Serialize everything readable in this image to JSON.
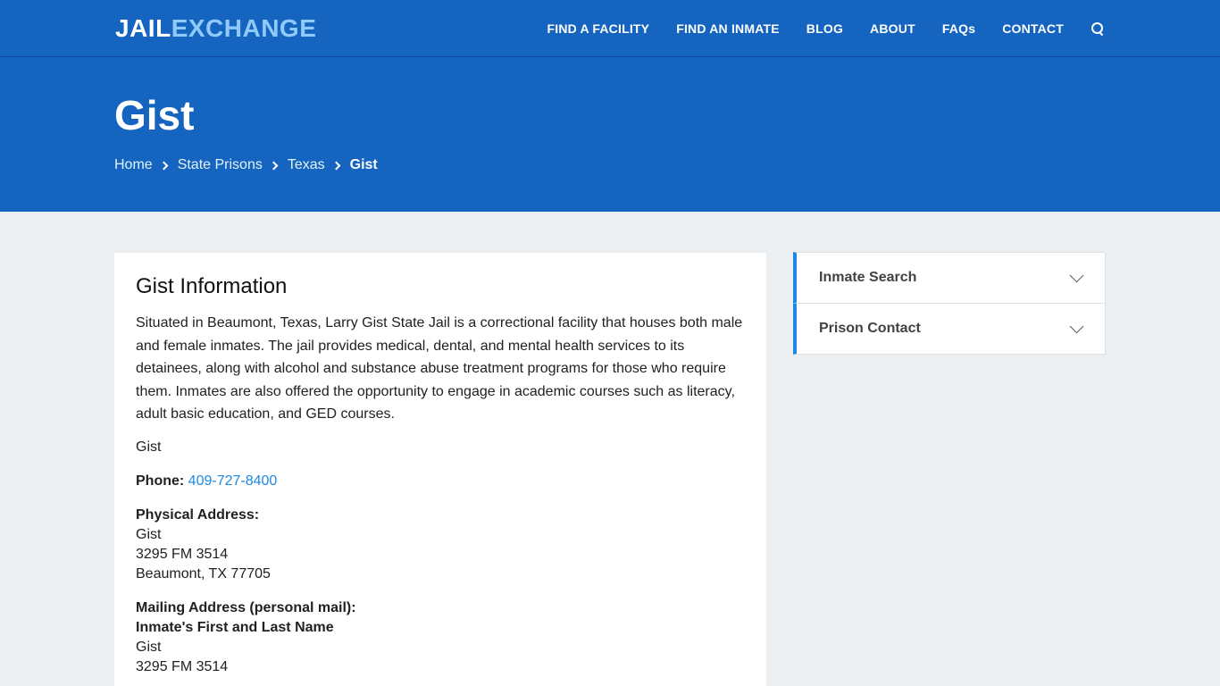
{
  "header": {
    "logo_part1": "JAIL",
    "logo_part2": "EXCHANGE",
    "nav": [
      "FIND A FACILITY",
      "FIND AN INMATE",
      "BLOG",
      "ABOUT",
      "FAQs",
      "CONTACT"
    ],
    "search_icon": "search-icon"
  },
  "hero": {
    "title": "Gist",
    "breadcrumb": [
      "Home",
      "State Prisons",
      "Texas",
      "Gist"
    ]
  },
  "main": {
    "heading": "Gist Information",
    "description": "Situated in Beaumont, Texas, Larry Gist State Jail is a correctional facility that houses both male and female inmates. The jail provides medical, dental, and mental health services to its detainees, along with alcohol and substance abuse treatment programs for those who require them. Inmates are also offered the opportunity to engage in academic courses such as literacy, adult basic education, and GED courses.",
    "facility_name": "Gist",
    "phone_label": "Phone:",
    "phone": "409-727-8400",
    "physical_label": "Physical Address:",
    "physical_lines": [
      "Gist",
      "3295 FM 3514",
      "Beaumont, TX 77705"
    ],
    "mailing_label": "Mailing Address (personal mail):",
    "mailing_name": "Inmate's First and Last Name",
    "mailing_lines": [
      "Gist",
      "3295 FM 3514"
    ]
  },
  "sidebar": {
    "items": [
      "Inmate Search",
      "Prison Contact"
    ]
  },
  "colors": {
    "brand_blue": "#1565c0",
    "accent_blue": "#1e88e5",
    "logo_light": "#90caf9",
    "page_bg": "#eceff1"
  }
}
